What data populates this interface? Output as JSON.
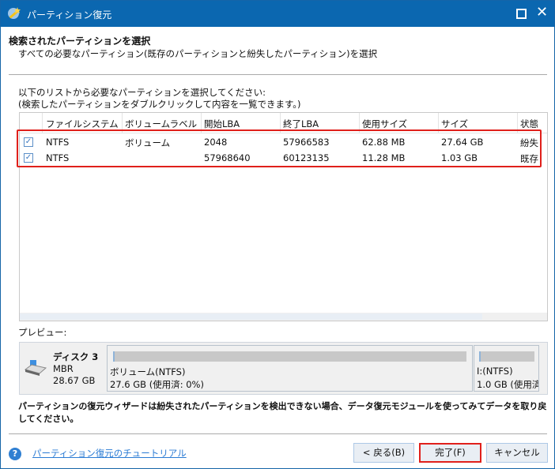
{
  "window": {
    "title": "パーティション復元"
  },
  "header": {
    "title": "検索されたパーティションを選択",
    "subtitle": "すべての必要なパーティション(既存のパーティションと紛失したパーティション)を選択"
  },
  "instructions": {
    "line1": "以下のリストから必要なパーティションを選択してください:",
    "line2": "(検索したパーティションをダブルクリックして内容を一覧できます。)"
  },
  "table": {
    "columns": [
      "ファイルシステム",
      "ボリュームラベル",
      "開始LBA",
      "終了LBA",
      "使用サイズ",
      "サイズ",
      "状態"
    ],
    "rows": [
      {
        "checked": true,
        "fs": "NTFS",
        "label": "ボリューム",
        "start": "2048",
        "end": "57966583",
        "used": "62.88 MB",
        "size": "27.64 GB",
        "status": "紛失"
      },
      {
        "checked": true,
        "fs": "NTFS",
        "label": "",
        "start": "57968640",
        "end": "60123135",
        "used": "11.28 MB",
        "size": "1.03 GB",
        "status": "既存"
      }
    ]
  },
  "preview": {
    "label": "プレビュー:",
    "disk": {
      "name": "ディスク 3",
      "type": "MBR",
      "size": "28.67 GB"
    },
    "partitions": [
      {
        "name": "ボリューム(NTFS)",
        "info": "27.6 GB (使用済: 0%)"
      },
      {
        "name": "I:(NTFS)",
        "info": "1.0 GB (使用済"
      }
    ]
  },
  "note": {
    "line1": "パーティションの復元ウィザードは紛失されたパーティションを検出できない場合、データ復元モジュールを使ってみてデータを取り戻",
    "line2": "してください。"
  },
  "footer": {
    "help_icon": "?",
    "tutorial_link": "パーティション復元のチュートリアル",
    "back": "< 戻る(B)",
    "finish": "完了(F)",
    "cancel": "キャンセル"
  },
  "colors": {
    "titlebar": "#0b67b0",
    "highlight": "#e0201b",
    "link": "#2a7bd4"
  }
}
